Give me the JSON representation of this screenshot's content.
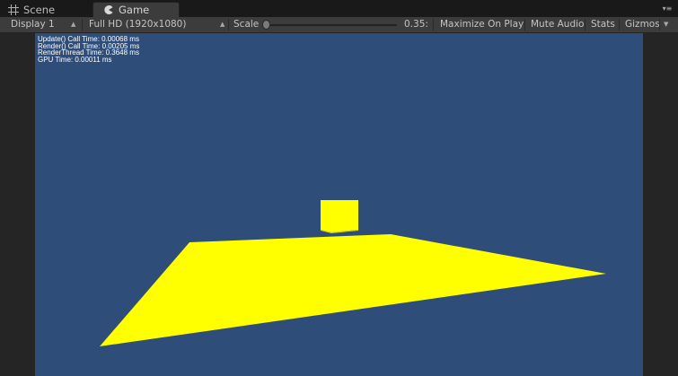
{
  "tabs": [
    {
      "label": "Scene",
      "icon": "grid-icon"
    },
    {
      "label": "Game",
      "icon": "pacman-icon"
    }
  ],
  "toolbar": {
    "display": "Display 1",
    "resolution": "Full HD (1920x1080)",
    "scale_label": "Scale",
    "scale_value": "0.35:",
    "scale_level": 0.0,
    "maximize": "Maximize On Play",
    "mute": "Mute Audio",
    "stats": "Stats",
    "gizmos": "Gizmos"
  },
  "stats_overlay": [
    "Update() Call Time: 0.00068 ms",
    "Render() Call Time: 0.00205 ms",
    "RenderThread Time: 0.3648 ms",
    "GPU Time: 0.00011 ms"
  ],
  "scene": {
    "sky_color": "#2e4d78",
    "object_color": "#ffff00",
    "objects": [
      "cube",
      "plane"
    ]
  }
}
